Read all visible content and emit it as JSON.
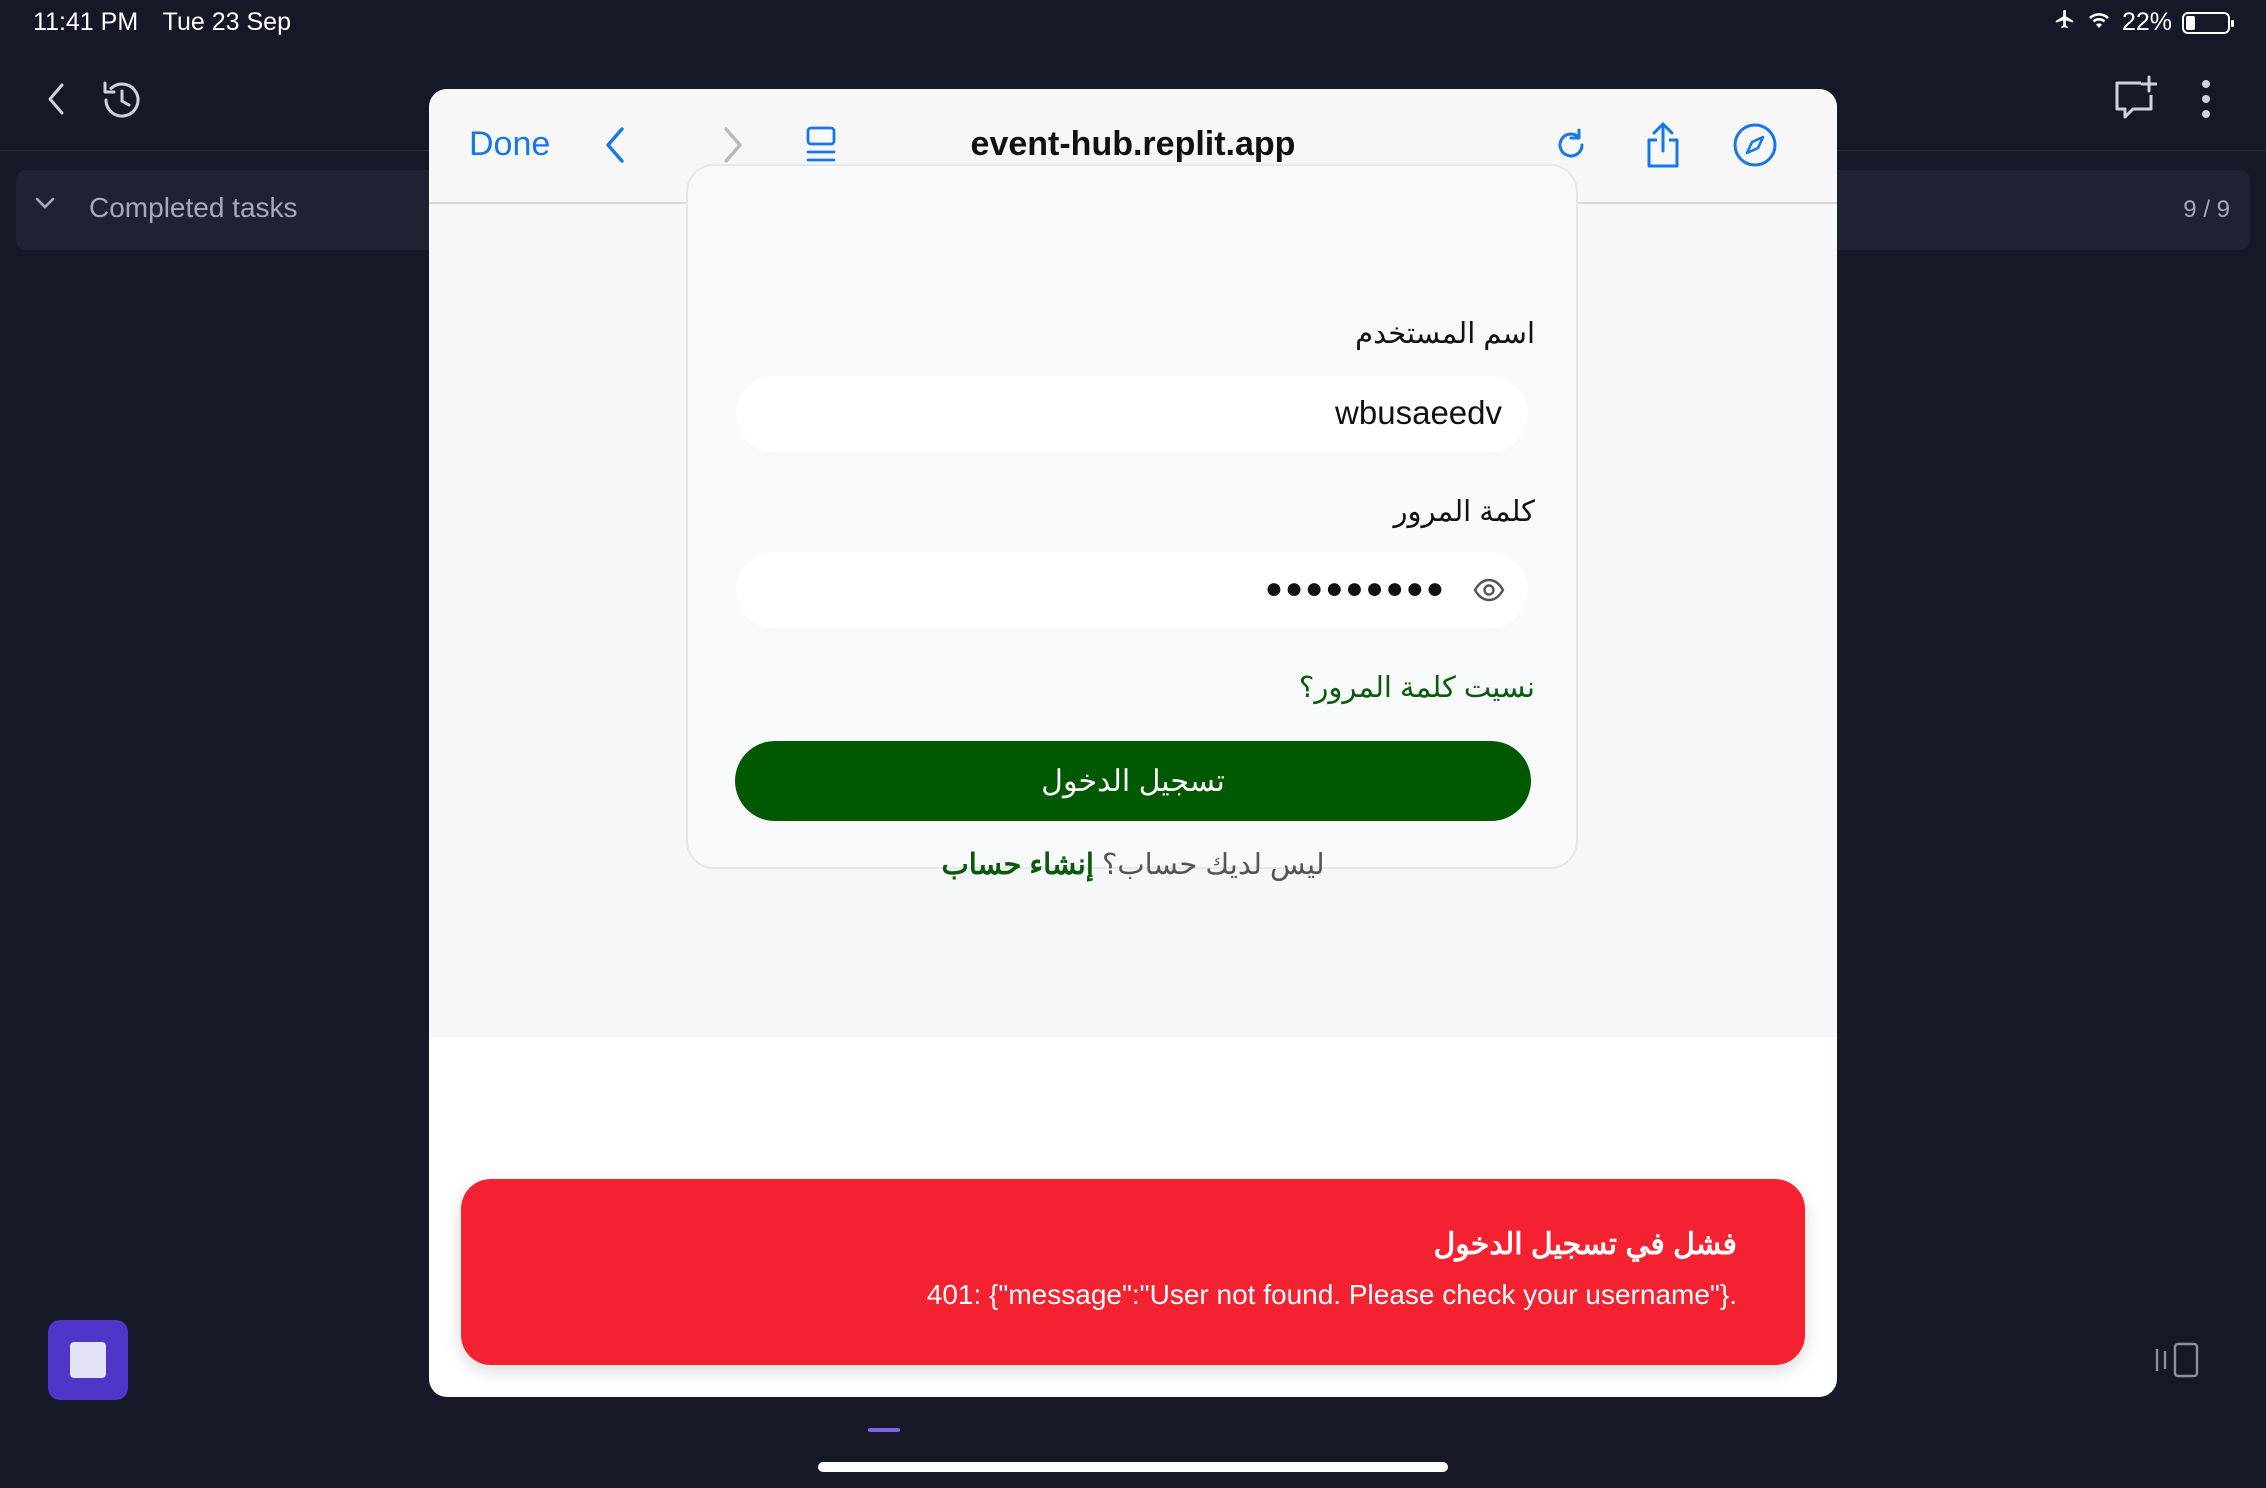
{
  "status_bar": {
    "time": "11:41 PM",
    "date": "Tue 23 Sep",
    "battery": "22%",
    "battery_level": 0.22
  },
  "background_app": {
    "tasks_section": {
      "label": "Completed tasks",
      "count": "9 / 9"
    },
    "icons": [
      "back-icon",
      "history-icon",
      "new-chat-icon",
      "more-icon",
      "stop-icon",
      "panel-toggle-icon"
    ]
  },
  "browser": {
    "done_label": "Done",
    "url": "event-hub.replit.app",
    "icons": [
      "back-icon",
      "forward-icon",
      "tabs-icon",
      "reload-icon",
      "share-icon",
      "safari-icon"
    ]
  },
  "login_form": {
    "username_label": "اسم المستخدم",
    "username_value": "wbusaeedv",
    "password_label": "كلمة المرور",
    "password_mask": "●●●●●●●●●",
    "forgot_link": "نسيت كلمة المرور؟",
    "login_button": "تسجيل الدخول",
    "signup_prompt": "ليس لديك حساب؟",
    "signup_link": "إنشاء حساب"
  },
  "toast": {
    "title": "فشل في تسجيل الدخول",
    "message": "401: {\"message\":\"User not found. Please check your username\"}.",
    "color": "#f42131"
  },
  "colors": {
    "accent": "#1677e6",
    "brand_green": "#005800",
    "error": "#f42131",
    "stop_button": "#4f35c8"
  }
}
